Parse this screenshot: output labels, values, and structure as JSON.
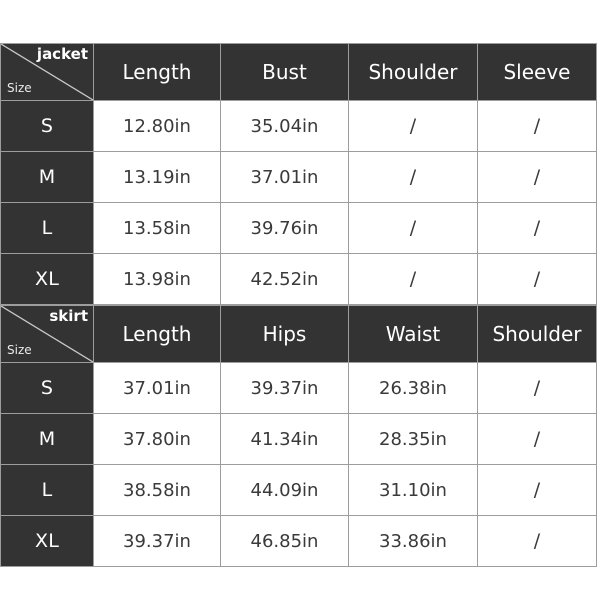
{
  "chart_data": {
    "type": "table",
    "title": "",
    "tables": [
      {
        "category": "jacket",
        "size_label": "Size",
        "columns": [
          "Length",
          "Bust",
          "Shoulder",
          "Sleeve"
        ],
        "rows": [
          {
            "size": "S",
            "values": [
              "12.80in",
              "35.04in",
              "/",
              "/"
            ]
          },
          {
            "size": "M",
            "values": [
              "13.19in",
              "37.01in",
              "/",
              "/"
            ]
          },
          {
            "size": "L",
            "values": [
              "13.58in",
              "39.76in",
              "/",
              "/"
            ]
          },
          {
            "size": "XL",
            "values": [
              "13.98in",
              "42.52in",
              "/",
              "/"
            ]
          }
        ]
      },
      {
        "category": "skirt",
        "size_label": "Size",
        "columns": [
          "Length",
          "Hips",
          "Waist",
          "Shoulder"
        ],
        "rows": [
          {
            "size": "S",
            "values": [
              "37.01in",
              "39.37in",
              "26.38in",
              "/"
            ]
          },
          {
            "size": "M",
            "values": [
              "37.80in",
              "41.34in",
              "28.35in",
              "/"
            ]
          },
          {
            "size": "L",
            "values": [
              "38.58in",
              "44.09in",
              "31.10in",
              "/"
            ]
          },
          {
            "size": "XL",
            "values": [
              "39.37in",
              "46.85in",
              "33.86in",
              "/"
            ]
          }
        ]
      }
    ]
  },
  "tables": [
    {
      "category": "jacket",
      "size_label": "Size",
      "columns": [
        "Length",
        "Bust",
        "Shoulder",
        "Sleeve"
      ],
      "rows": [
        {
          "size": "S",
          "c0": "12.80in",
          "c1": "35.04in",
          "c2": "/",
          "c3": "/"
        },
        {
          "size": "M",
          "c0": "13.19in",
          "c1": "37.01in",
          "c2": "/",
          "c3": "/"
        },
        {
          "size": "L",
          "c0": "13.58in",
          "c1": "39.76in",
          "c2": "/",
          "c3": "/"
        },
        {
          "size": "XL",
          "c0": "13.98in",
          "c1": "42.52in",
          "c2": "/",
          "c3": "/"
        }
      ]
    },
    {
      "category": "skirt",
      "size_label": "Size",
      "columns": [
        "Length",
        "Hips",
        "Waist",
        "Shoulder"
      ],
      "rows": [
        {
          "size": "S",
          "c0": "37.01in",
          "c1": "39.37in",
          "c2": "26.38in",
          "c3": "/"
        },
        {
          "size": "M",
          "c0": "37.80in",
          "c1": "41.34in",
          "c2": "28.35in",
          "c3": "/"
        },
        {
          "size": "L",
          "c0": "38.58in",
          "c1": "44.09in",
          "c2": "31.10in",
          "c3": "/"
        },
        {
          "size": "XL",
          "c0": "39.37in",
          "c1": "46.85in",
          "c2": "33.86in",
          "c3": "/"
        }
      ]
    }
  ],
  "colors": {
    "header_bg": "#333333",
    "header_text": "#ffffff",
    "cell_bg": "#ffffff",
    "cell_text": "#3a3a3a",
    "border": "#9d9d9d",
    "page_bg": "#ffffff"
  }
}
